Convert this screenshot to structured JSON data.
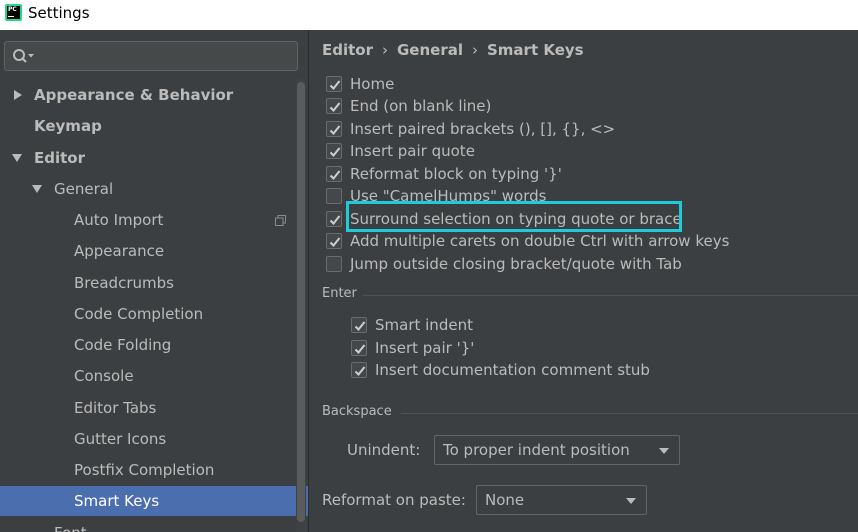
{
  "window": {
    "title": "Settings",
    "app_icon": "pycharm-logo",
    "app_icon_text": "PC"
  },
  "search": {
    "placeholder": "",
    "value": ""
  },
  "sidebar": {
    "items": [
      {
        "label": "Appearance & Behavior",
        "expanded": false
      },
      {
        "label": "Keymap"
      },
      {
        "label": "Editor",
        "expanded": true
      },
      {
        "label": "General",
        "expanded": true
      },
      {
        "label": "Auto Import"
      },
      {
        "label": "Appearance"
      },
      {
        "label": "Breadcrumbs"
      },
      {
        "label": "Code Completion"
      },
      {
        "label": "Code Folding"
      },
      {
        "label": "Console"
      },
      {
        "label": "Editor Tabs"
      },
      {
        "label": "Gutter Icons"
      },
      {
        "label": "Postfix Completion"
      },
      {
        "label": "Smart Keys",
        "selected": true
      },
      {
        "label": "Font"
      }
    ]
  },
  "breadcrumb": {
    "parts": [
      "Editor",
      "General",
      "Smart Keys"
    ],
    "separator": "›"
  },
  "options": [
    {
      "label": "Home",
      "checked": true
    },
    {
      "label": "End (on blank line)",
      "checked": true
    },
    {
      "label": "Insert paired brackets (), [], {}, <>",
      "checked": true
    },
    {
      "label": "Insert pair quote",
      "checked": true
    },
    {
      "label": "Reformat block on typing '}'",
      "checked": true
    },
    {
      "label": "Use \"CamelHumps\" words",
      "checked": false
    },
    {
      "label": "Surround selection on typing quote or brace",
      "checked": true,
      "highlighted": true
    },
    {
      "label": "Add multiple carets on double Ctrl with arrow keys",
      "checked": true
    },
    {
      "label": "Jump outside closing bracket/quote with Tab",
      "checked": false
    }
  ],
  "enter": {
    "title": "Enter",
    "options": [
      {
        "label": "Smart indent",
        "checked": true
      },
      {
        "label": "Insert pair '}'",
        "checked": true
      },
      {
        "label": "Insert documentation comment stub",
        "checked": true
      }
    ]
  },
  "backspace": {
    "title": "Backspace",
    "unindent_label": "Unindent:",
    "unindent_value": "To proper indent position"
  },
  "reformat": {
    "label": "Reformat on paste:",
    "value": "None"
  },
  "colors": {
    "selection": "#4b6eaf",
    "highlight": "#1ecbd8",
    "background": "#3c3f41"
  }
}
